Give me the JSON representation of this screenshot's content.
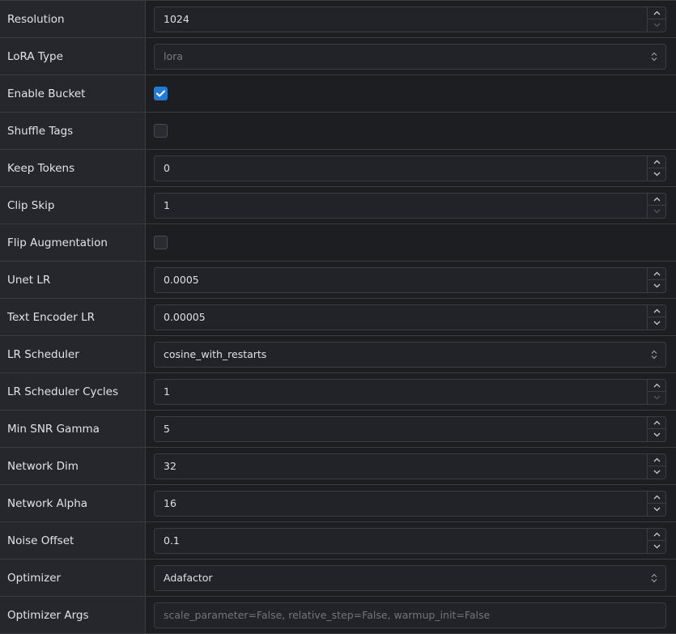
{
  "rows": [
    {
      "label": "Resolution",
      "type": "number",
      "value": "1024",
      "down_disabled": true
    },
    {
      "label": "LoRA Type",
      "type": "select",
      "value": "lora",
      "disabled": true
    },
    {
      "label": "Enable Bucket",
      "type": "checkbox",
      "checked": true
    },
    {
      "label": "Shuffle Tags",
      "type": "checkbox",
      "checked": false
    },
    {
      "label": "Keep Tokens",
      "type": "number",
      "value": "0"
    },
    {
      "label": "Clip Skip",
      "type": "number",
      "value": "1",
      "down_disabled": true
    },
    {
      "label": "Flip Augmentation",
      "type": "checkbox",
      "checked": false
    },
    {
      "label": "Unet LR",
      "type": "number",
      "value": "0.0005"
    },
    {
      "label": "Text Encoder LR",
      "type": "number",
      "value": "0.00005"
    },
    {
      "label": "LR Scheduler",
      "type": "select",
      "value": "cosine_with_restarts"
    },
    {
      "label": "LR Scheduler Cycles",
      "type": "number",
      "value": "1",
      "down_disabled": true
    },
    {
      "label": "Min SNR Gamma",
      "type": "number",
      "value": "5"
    },
    {
      "label": "Network Dim",
      "type": "number",
      "value": "32"
    },
    {
      "label": "Network Alpha",
      "type": "number",
      "value": "16"
    },
    {
      "label": "Noise Offset",
      "type": "number",
      "value": "0.1"
    },
    {
      "label": "Optimizer",
      "type": "select",
      "value": "Adafactor"
    },
    {
      "label": "Optimizer Args",
      "type": "text",
      "value": "",
      "placeholder": "scale_parameter=False, relative_step=False, warmup_init=False"
    }
  ],
  "icons": {
    "up": "chevron-up-icon",
    "down": "chevron-down-icon",
    "select": "select-arrows-icon",
    "check": "checkmark-icon"
  },
  "colors": {
    "accent": "#1f7ad8",
    "label_bg": "#26272c",
    "value_bg": "#1d1e22",
    "border": "#3a3b40"
  }
}
